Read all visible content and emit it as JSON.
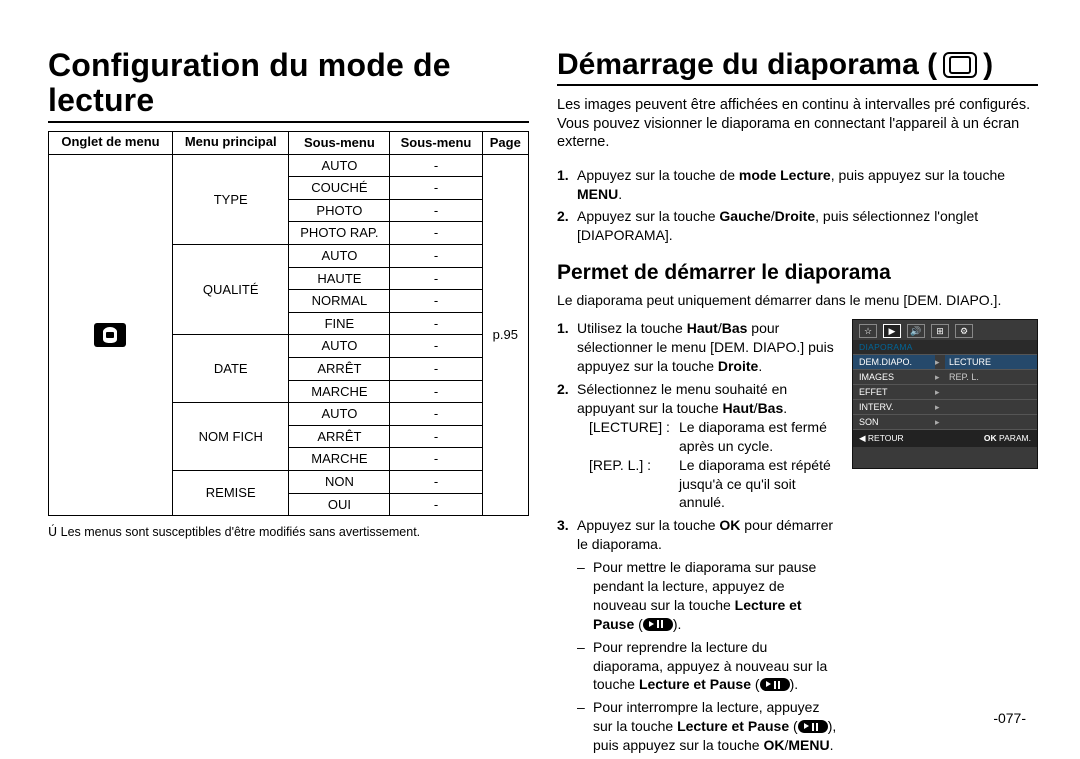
{
  "left": {
    "title": "Conﬁguration du mode de lecture",
    "headers": {
      "onglet": "Onglet de menu",
      "menu": "Menu principal",
      "sous1": "Sous-menu",
      "sous2": "Sous-menu",
      "page": "Page"
    },
    "page_ref": "p.95",
    "groups": [
      {
        "menu": "TYPE",
        "rows": [
          {
            "s1": "AUTO",
            "s2": "-"
          },
          {
            "s1": "COUCHÉ",
            "s2": "-"
          },
          {
            "s1": "PHOTO",
            "s2": "-"
          },
          {
            "s1": "PHOTO RAP.",
            "s2": "-"
          }
        ]
      },
      {
        "menu": "QUALITÉ",
        "rows": [
          {
            "s1": "AUTO",
            "s2": "-"
          },
          {
            "s1": "HAUTE",
            "s2": "-"
          },
          {
            "s1": "NORMAL",
            "s2": "-"
          },
          {
            "s1": "FINE",
            "s2": "-"
          }
        ]
      },
      {
        "menu": "DATE",
        "rows": [
          {
            "s1": "AUTO",
            "s2": "-"
          },
          {
            "s1": "ARRÊT",
            "s2": "-"
          },
          {
            "s1": "MARCHE",
            "s2": "-"
          }
        ]
      },
      {
        "menu": "NOM FICH",
        "rows": [
          {
            "s1": "AUTO",
            "s2": "-"
          },
          {
            "s1": "ARRÊT",
            "s2": "-"
          },
          {
            "s1": "MARCHE",
            "s2": "-"
          }
        ]
      },
      {
        "menu": "REMISE",
        "rows": [
          {
            "s1": "NON",
            "s2": "-"
          },
          {
            "s1": "OUI",
            "s2": "-"
          }
        ]
      }
    ],
    "footnote_star": "Ú",
    "footnote": "Les menus sont susceptibles d'être modiﬁés sans avertissement."
  },
  "right": {
    "title": "Démarrage du diaporama (",
    "title_close": ")",
    "intro": "Les images peuvent être afﬁchées en continu à intervalles pré conﬁgurés. Vous pouvez visionner le diaporama en connectant l'appareil à un écran externe.",
    "steps1": [
      {
        "num": "1.",
        "pre": "Appuyez sur la touche de ",
        "b1": "mode Lecture",
        "mid": ", puis appuyez sur la touche ",
        "b2": "MENU",
        "post": "."
      },
      {
        "num": "2.",
        "pre": "Appuyez sur la touche ",
        "b1": "Gauche",
        "slash": "/",
        "b2": "Droite",
        "post": ", puis sélectionnez l'onglet [DIAPORAMA]."
      }
    ],
    "subheading": "Permet de démarrer le diaporama",
    "subintro": "Le diaporama peut uniquement démarrer dans le menu [DEM. DIAPO.].",
    "steps2": {
      "s1": {
        "num": "1.",
        "t1": "Utilisez la touche ",
        "b1": "Haut",
        "slash": "/",
        "b2": "Bas",
        "t2": " pour sélectionner le menu [DEM. DIAPO.] puis appuyez sur la touche ",
        "b3": "Droite",
        "t3": "."
      },
      "s2": {
        "num": "2.",
        "t1": "Sélectionnez le menu souhaité en appuyant sur la touche ",
        "b1": "Haut",
        "slash": "/",
        "b2": "Bas",
        "t2": ".",
        "kv": [
          {
            "k": "[LECTURE] :",
            "v": "Le diaporama est fermé après un cycle."
          },
          {
            "k": "[REP. L.] :",
            "v": "Le diaporama est répété jusqu'à ce qu'il soit annulé."
          }
        ]
      },
      "s3": {
        "num": "3.",
        "t1": "Appuyez sur la touche ",
        "b1": "OK",
        "t2": " pour démarrer le diaporama.",
        "dash": [
          {
            "pre": "Pour mettre le diaporama sur pause pendant la lecture, appuyez de nouveau sur la touche ",
            "b": "Lecture et Pause",
            "post": " (",
            "post2": ")."
          },
          {
            "pre": "Pour reprendre la lecture du diaporama, appuyez à nouveau sur la touche ",
            "b": "Lecture et Pause",
            "post": " (",
            "post2": ")."
          },
          {
            "pre": "Pour interrompre la lecture, appuyez sur la touche ",
            "b": "Lecture et Pause",
            "post": " (",
            "mid": "), puis appuyez sur la touche ",
            "b2": "OK",
            "slash": "/",
            "b3": "MENU",
            "end": "."
          }
        ]
      }
    },
    "lcd": {
      "title": "DIAPORAMA",
      "rows": [
        {
          "lbl": "DEM.DIAPO.",
          "val": "LECTURE",
          "sel": true
        },
        {
          "lbl": "IMAGES",
          "val": "REP. L.",
          "sel": false
        },
        {
          "lbl": "EFFET",
          "val": "",
          "sel": false
        },
        {
          "lbl": "INTERV.",
          "val": "",
          "sel": false
        },
        {
          "lbl": "SON",
          "val": "",
          "sel": false
        }
      ],
      "back_sym": "◀",
      "back": "RETOUR",
      "ok": "OK",
      "param": "PARAM."
    }
  },
  "pagenum": "-077-"
}
